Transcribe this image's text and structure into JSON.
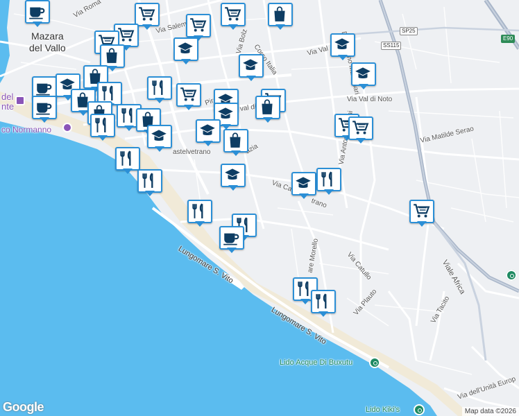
{
  "city_label": {
    "line1": "Mazara",
    "line2": "del Vallo"
  },
  "attribution": "Map data ©2026",
  "logo_text": "Google",
  "highway_shields": {
    "sp25": "SP25",
    "ss115": "SS115",
    "e90": "E90"
  },
  "street_labels": {
    "via_roma": "Via Roma",
    "via_salemi": "Via Salemi",
    "via_bolzano": "Via Bolz",
    "corso_italia": "Corso Italia",
    "don_primo_mazzolari": "Don Primo Mazzolari",
    "via_val": "Via Val",
    "via_val_di_noto": "Via Val di Noto",
    "val_di": "val di",
    "via_matilde_serao": "Via Matilde Serao",
    "via_antonio_segni": "Via Antonio Segni",
    "via_castelvetrano_left": "astelvetrano",
    "via_castelvetrano_right": "Via Ca",
    "via_castelvetrano_right2": "trano",
    "azia": "azia",
    "lungomare_1": "Lungomare S. Vito",
    "lungomare_2": "Lungomare S. Vito",
    "via_catullo": "Via Catullo",
    "via_plauto": "Via Plauto",
    "via_tacito": "Via Tacito",
    "viale_africa": "Viale Africa",
    "via_unita_europa": "Via dell'Unità Europ",
    "via_morello": "are Morello",
    "del_fragment": "del",
    "nte_fragment": "nte",
    "normanno": "co Normanno",
    "via_pirandello": "Pirano"
  },
  "pois": {
    "lido_buxutu": "Lido Acque Di Buxutu",
    "lido_kiki": "Lido Kiki's"
  },
  "colors": {
    "water": "#5bbcef",
    "land": "#eef0f3",
    "road": "#ffffff",
    "highway": "#a9b6c9",
    "marker_border": "#2b8fd6",
    "icon": "#0e3d63",
    "poi_green": "#1e8a62"
  },
  "markers": [
    {
      "type": "cafe-icon"
    },
    {
      "type": "cart-icon"
    },
    {
      "type": "cart-icon"
    },
    {
      "type": "cart-icon"
    },
    {
      "type": "shopping-bag-icon"
    },
    {
      "type": "cart-icon"
    },
    {
      "type": "cart-icon"
    },
    {
      "type": "shopping-bag-icon"
    },
    {
      "type": "school-icon"
    },
    {
      "type": "school-icon"
    },
    {
      "type": "school-icon"
    },
    {
      "type": "school-icon"
    },
    {
      "type": "cafe-icon"
    },
    {
      "type": "school-icon"
    },
    {
      "type": "shopping-bag-icon"
    },
    {
      "type": "restaurant-icon"
    },
    {
      "type": "shopping-bag-icon"
    },
    {
      "type": "cafe-icon"
    },
    {
      "type": "shopping-bag-icon"
    },
    {
      "type": "restaurant-icon"
    },
    {
      "type": "cart-icon"
    },
    {
      "type": "school-icon"
    },
    {
      "type": "school-icon"
    },
    {
      "type": "cart-icon"
    },
    {
      "type": "shopping-bag-icon"
    },
    {
      "type": "restaurant-icon"
    },
    {
      "type": "restaurant-icon"
    },
    {
      "type": "shopping-bag-icon"
    },
    {
      "type": "school-icon"
    },
    {
      "type": "school-icon"
    },
    {
      "type": "shopping-bag-icon"
    },
    {
      "type": "cart-icon"
    },
    {
      "type": "cart-icon"
    },
    {
      "type": "school-icon"
    },
    {
      "type": "restaurant-icon"
    },
    {
      "type": "restaurant-icon"
    },
    {
      "type": "school-icon"
    },
    {
      "type": "restaurant-icon"
    },
    {
      "type": "cart-icon"
    },
    {
      "type": "restaurant-icon"
    },
    {
      "type": "restaurant-icon"
    },
    {
      "type": "cafe-icon"
    },
    {
      "type": "restaurant-icon"
    },
    {
      "type": "restaurant-icon"
    }
  ]
}
